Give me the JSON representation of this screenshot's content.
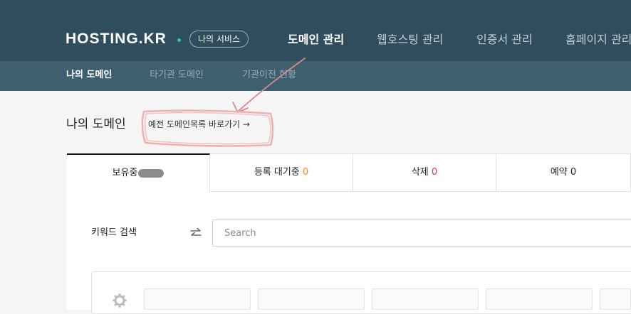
{
  "header": {
    "logo": "HOSTING.KR",
    "my_service": "나의 서비스",
    "nav": [
      "도메인 관리",
      "웹호스팅 관리",
      "인증서 관리",
      "홈페이지 관리"
    ]
  },
  "subnav": [
    "나의 도메인",
    "타기관 도메인",
    "기관이전 현황"
  ],
  "page": {
    "title": "나의 도메인",
    "old_list_link": "예전 도메인목록 바로가기 →"
  },
  "tabs": [
    {
      "label": "보유중",
      "count": ""
    },
    {
      "label": "등록 대기중",
      "count": "0"
    },
    {
      "label": "삭제",
      "count": "0"
    },
    {
      "label": "예약",
      "count": "0"
    }
  ],
  "search": {
    "label": "키워드 검색",
    "placeholder": "Search"
  },
  "filters": [
    "",
    "",
    "",
    "",
    ""
  ],
  "colors": {
    "header_bg": "#2f4d5c",
    "subnav_bg": "#3d5f6e",
    "count_orange": "#f08a24",
    "count_red": "#e03b3b",
    "annotation": "#e8a0a0"
  }
}
